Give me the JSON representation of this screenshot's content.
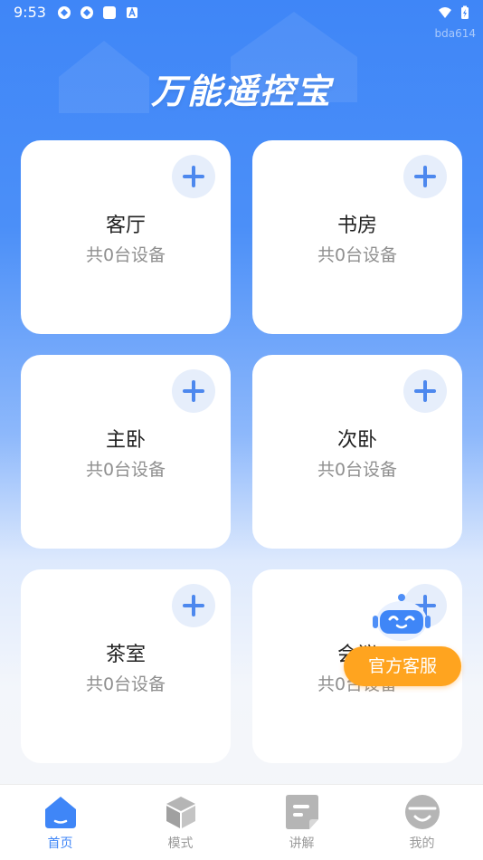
{
  "status_bar": {
    "time": "9:53",
    "tag": "bda614"
  },
  "app": {
    "title": "万能遥控宝"
  },
  "rooms": [
    {
      "name": "客厅",
      "count_text": "共0台设备"
    },
    {
      "name": "书房",
      "count_text": "共0台设备"
    },
    {
      "name": "主卧",
      "count_text": "共0台设备"
    },
    {
      "name": "次卧",
      "count_text": "共0台设备"
    },
    {
      "name": "茶室",
      "count_text": "共0台设备"
    },
    {
      "name": "会议",
      "count_text": "共0台设备"
    }
  ],
  "service": {
    "label": "官方客服"
  },
  "tabs": [
    {
      "label": "首页",
      "icon": "home-icon",
      "active": true
    },
    {
      "label": "模式",
      "icon": "cube-icon",
      "active": false
    },
    {
      "label": "讲解",
      "icon": "document-icon",
      "active": false
    },
    {
      "label": "我的",
      "icon": "profile-icon",
      "active": false
    }
  ],
  "colors": {
    "primary": "#3f86f7",
    "accent": "#ffa41f",
    "add_button_bg": "#e6eefb",
    "inactive_tab": "#9a9a9a"
  }
}
